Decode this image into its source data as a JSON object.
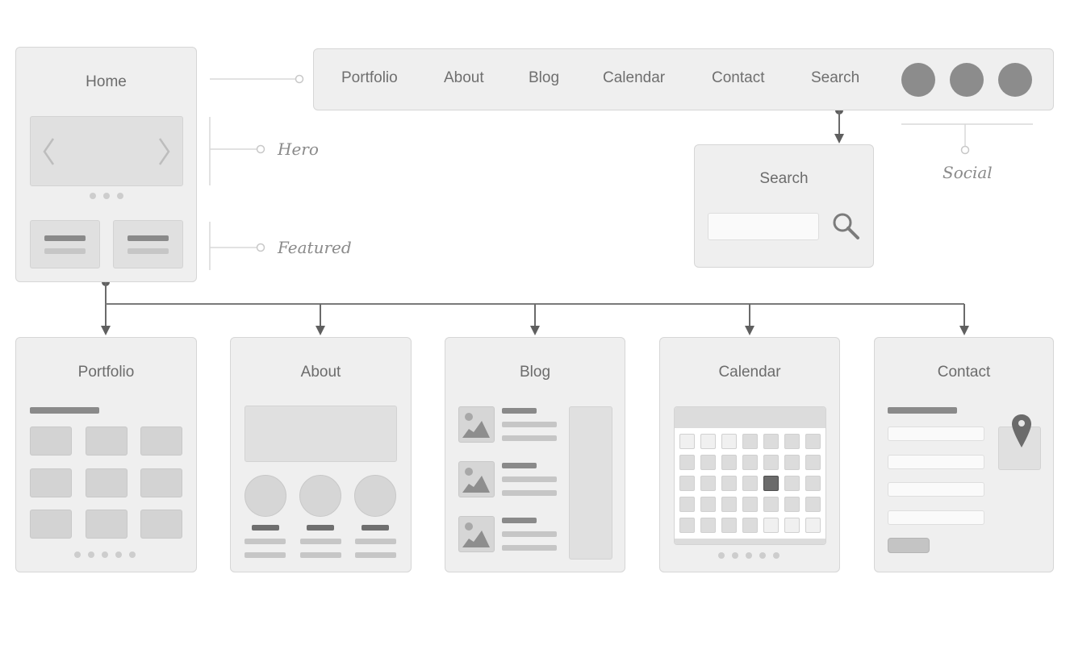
{
  "home": {
    "title": "Home",
    "annotations": {
      "hero": "Hero",
      "featured": "Featured"
    }
  },
  "nav": {
    "items": [
      "Portfolio",
      "About",
      "Blog",
      "Calendar",
      "Contact",
      "Search"
    ],
    "social_icons": [
      "social-circle",
      "social-circle",
      "social-circle"
    ],
    "social_label": "Social"
  },
  "search_page": {
    "title": "Search",
    "input_value": "",
    "icon": "search-icon"
  },
  "pages": {
    "portfolio": {
      "title": "Portfolio"
    },
    "about": {
      "title": "About"
    },
    "blog": {
      "title": "Blog"
    },
    "calendar": {
      "title": "Calendar",
      "highlighted_day": {
        "week": 3,
        "weekday": 5
      }
    },
    "contact": {
      "title": "Contact",
      "icon": "map-pin-icon"
    }
  },
  "colors": {
    "card_bg": "#efefef",
    "card_border": "#d6d6d6",
    "connector": "#6a6a6a",
    "annotation_line": "#d8d8d8",
    "highlight": "#6b6b6b"
  }
}
